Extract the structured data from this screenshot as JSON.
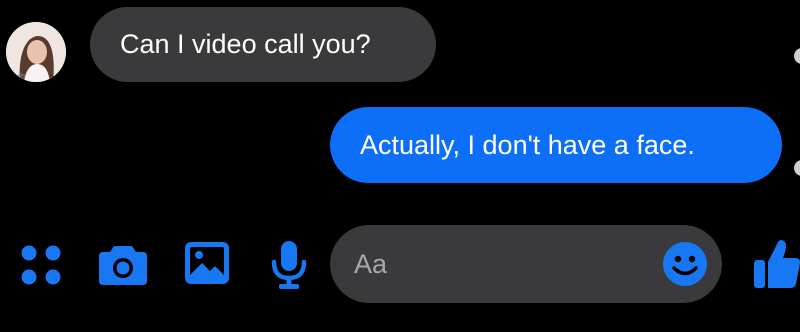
{
  "conversation": {
    "messages": [
      {
        "direction": "incoming",
        "text": "Can I video call you?"
      },
      {
        "direction": "outgoing",
        "text": "Actually, I don't have a face."
      }
    ]
  },
  "composer": {
    "placeholder": "Aa",
    "value": ""
  },
  "toolbar": {
    "icons": [
      "apps-icon",
      "camera-icon",
      "image-icon",
      "microphone-icon"
    ],
    "emoji_icon": "emoji-icon",
    "like_icon": "thumbs-up-icon"
  },
  "colors": {
    "background": "#000000",
    "incoming_bubble": "#3a3a3c",
    "outgoing_bubble": "#0d6ef8",
    "accent": "#1877f2",
    "text": "#ffffff"
  }
}
